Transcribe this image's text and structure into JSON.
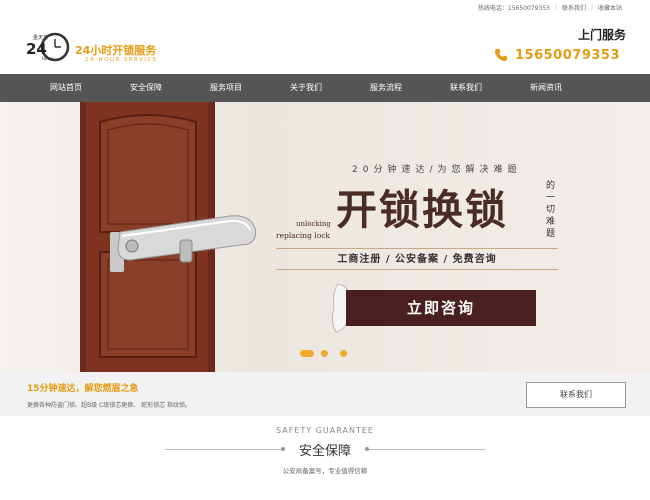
{
  "topbar": {
    "hotline": "热线电话：15650079353",
    "contact": "联系我们",
    "favorite": "收藏本站"
  },
  "header": {
    "logo_badge_top": "金天龙",
    "logo_badge_num": "24",
    "logo_badge_hours": "Hours",
    "logo_title": "24小时开锁服务",
    "logo_subtitle": "24-HOUR SERVICE",
    "service_label": "上门服务",
    "phone": "15650079353"
  },
  "nav": {
    "items": [
      {
        "label": "网站首页"
      },
      {
        "label": "安全保障"
      },
      {
        "label": "服务项目"
      },
      {
        "label": "关于我们"
      },
      {
        "label": "服务流程"
      },
      {
        "label": "联系我们"
      },
      {
        "label": "新闻资讯"
      }
    ]
  },
  "banner": {
    "line1": "20分钟速达/为您解决难题",
    "headline": "开锁换锁",
    "side_text": "的一切难题",
    "en_line1": "unlocking",
    "en_line2": "replacing lock",
    "tags": "工商注册 / 公安备案 / 免费咨询",
    "cta": "立即咨询",
    "slides": 3,
    "active_slide": 1
  },
  "strip": {
    "title": "15分钟速达，解您燃眉之急",
    "desc": "更换各种防盗门锁、超B级 C级锁芯更换、 蛇形锁芯 指纹锁。",
    "button": "联系我们"
  },
  "section": {
    "en_title": "SAFETY GUARANTEE",
    "cn_title": "安全保障",
    "subtitle": "公安局备案号，专业值得信赖"
  },
  "colors": {
    "accent": "#e59b12",
    "nav_bg": "#555555",
    "cta_bg": "#4a1f21",
    "headline": "#4a2b26"
  }
}
